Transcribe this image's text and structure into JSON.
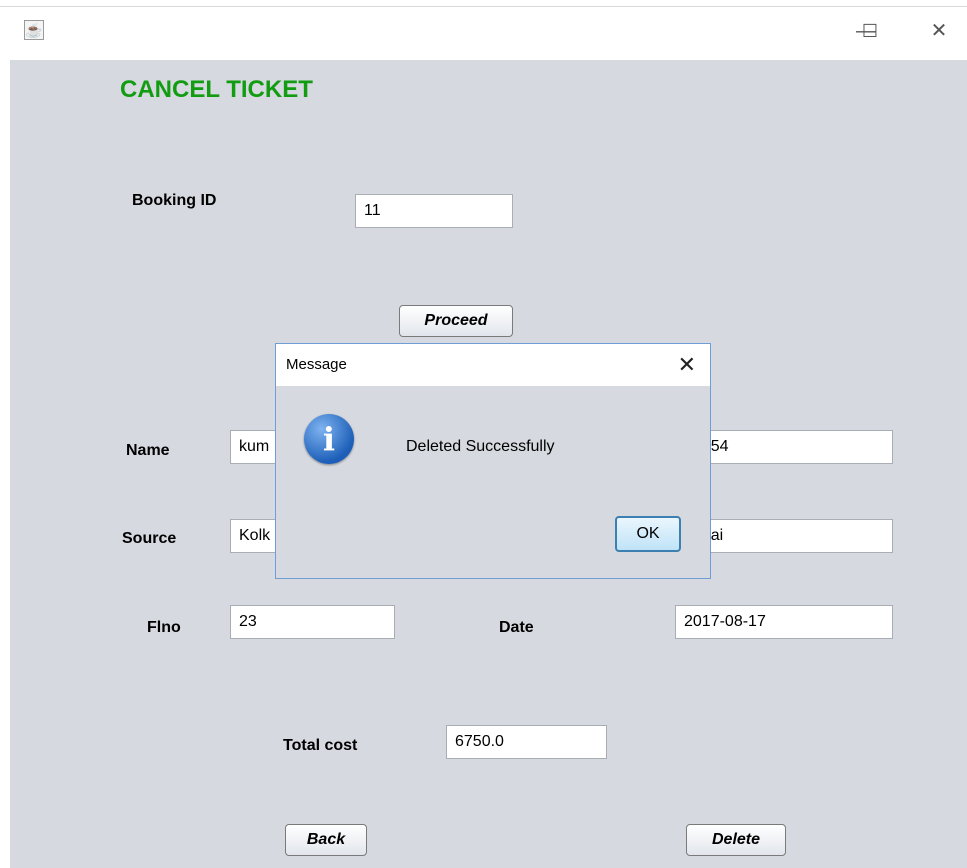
{
  "window": {
    "app_icon": "java-app-icon",
    "minimize_glyph": "—",
    "maximize_glyph": "☐",
    "close_glyph": "✕"
  },
  "form": {
    "title": "CANCEL TICKET",
    "booking_id_label": "Booking ID",
    "booking_id_value": "11",
    "proceed_label": "Proceed",
    "name_label": "Name",
    "name_value": "kum",
    "phone_value": "37654",
    "source_label": "Source",
    "source_value": "Kolk",
    "destination_value": "ennai",
    "flno_label": "Flno",
    "flno_value": "23",
    "date_label": "Date",
    "date_value": "2017-08-17",
    "total_cost_label": "Total cost",
    "total_cost_value": "6750.0",
    "back_label": "Back",
    "delete_label": "Delete"
  },
  "dialog": {
    "title": "Message",
    "close_glyph": "✕",
    "icon": "info-icon",
    "icon_glyph": "i",
    "message": "Deleted Successfully",
    "ok_label": "OK"
  },
  "colors": {
    "title_green": "#129c12",
    "panel_bg": "#d6d9df",
    "dialog_border": "#6f9ed4"
  }
}
